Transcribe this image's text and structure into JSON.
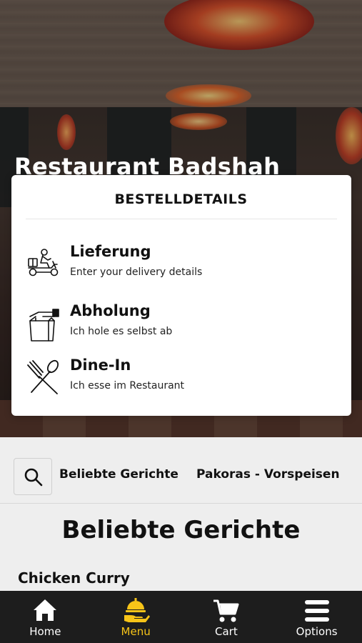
{
  "restaurant": {
    "name": "Restaurant Badshah"
  },
  "modal": {
    "title": "BESTELLDETAILS",
    "options": [
      {
        "icon": "scooter-delivery-icon",
        "title": "Lieferung",
        "subtitle": "Enter your delivery details"
      },
      {
        "icon": "takeaway-bag-icon",
        "title": "Abholung",
        "subtitle": "Ich hole es selbst ab"
      },
      {
        "icon": "fork-spoon-icon",
        "title": "Dine-In",
        "subtitle": "Ich esse im Restaurant"
      }
    ]
  },
  "categories": {
    "search_icon": "search-icon",
    "tabs": [
      "Beliebte Gerichte",
      "Pakoras - Vorspeisen"
    ]
  },
  "section": {
    "title": "Beliebte Gerichte"
  },
  "dishes": [
    {
      "name": "Chicken Curry"
    }
  ],
  "bottom_nav": {
    "items": [
      {
        "icon": "home-icon",
        "label": "Home"
      },
      {
        "icon": "serving-hand-icon",
        "label": "Menu",
        "active": true
      },
      {
        "icon": "cart-icon",
        "label": "Cart"
      },
      {
        "icon": "hamburger-menu-icon",
        "label": "Options"
      }
    ]
  },
  "colors": {
    "accent": "#f7c418",
    "nav_bg": "#1d1d1d",
    "card_bg": "#ffffff",
    "page_bg": "#eeeeee"
  }
}
